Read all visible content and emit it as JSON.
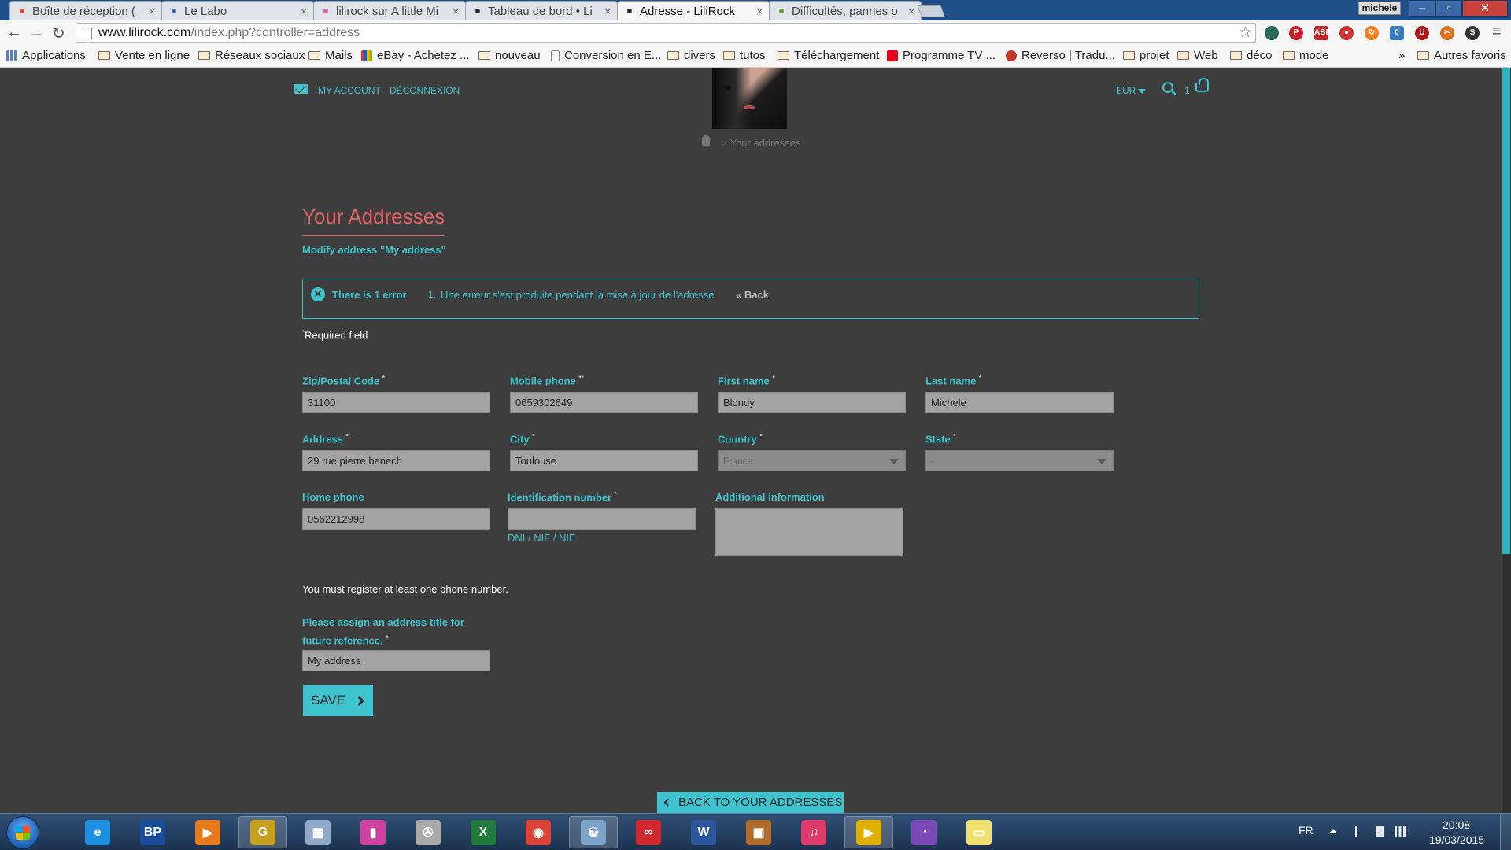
{
  "browser": {
    "tabs": [
      {
        "label": "Boîte de réception (",
        "favicon": "gmail-icon",
        "color": "#d44638"
      },
      {
        "label": "Le Labo",
        "favicon": "facebook-icon",
        "color": "#3b5998"
      },
      {
        "label": "lilirock sur A little Mi",
        "favicon": "pink-icon",
        "color": "#d85aa8"
      },
      {
        "label": "Tableau de bord • Li",
        "favicon": "prestashop-icon",
        "color": "#222222"
      },
      {
        "label": "Adresse - LiliRock",
        "favicon": "prestashop-icon",
        "color": "#222222"
      },
      {
        "label": "Difficultés, pannes o",
        "favicon": "forum-icon",
        "color": "#5a9e2f"
      }
    ],
    "close_glyph": "×",
    "user": "michele",
    "url_host": "www.lilirock.com",
    "url_path": "/index.php?controller=address",
    "bookmarks": [
      {
        "label": "Applications",
        "type": "apps"
      },
      {
        "label": "Vente en ligne",
        "type": "folder"
      },
      {
        "label": "Réseaux sociaux",
        "type": "folder"
      },
      {
        "label": "Mails",
        "type": "folder"
      },
      {
        "label": "eBay - Achetez ...",
        "type": "ebay"
      },
      {
        "label": "nouveau",
        "type": "folder"
      },
      {
        "label": "Conversion en E...",
        "type": "page"
      },
      {
        "label": "divers",
        "type": "folder"
      },
      {
        "label": "tutos",
        "type": "folder"
      },
      {
        "label": "Téléchargement",
        "type": "folder"
      },
      {
        "label": "Programme TV ...",
        "type": "sfr"
      },
      {
        "label": "Reverso | Tradu...",
        "type": "reverso"
      },
      {
        "label": "projet",
        "type": "folder"
      },
      {
        "label": "Web",
        "type": "folder"
      },
      {
        "label": "déco",
        "type": "folder"
      },
      {
        "label": "mode",
        "type": "folder"
      }
    ],
    "bookmarks_overflow": "»",
    "other_bookmarks": "Autres favoris"
  },
  "header": {
    "my_account": "MY ACCOUNT",
    "logout": "DÉCONNEXION",
    "currency": "EUR",
    "cart_count": "1"
  },
  "breadcrumb": {
    "separator": ">",
    "current": "Your addresses"
  },
  "form": {
    "title": "Your Addresses",
    "subheading": "Modify address \"My address\"",
    "error": {
      "title": "There is 1 error",
      "number": "1.",
      "message": "Une erreur s'est produite pendant la mise à jour de l'adresse",
      "back": "« Back"
    },
    "required_mark": "*",
    "required_note": "Required field",
    "fields": {
      "zip": {
        "label": "Zip/Postal Code",
        "mark": "*",
        "value": "31100"
      },
      "mobile": {
        "label": "Mobile phone",
        "mark": "**",
        "value": "0659302649"
      },
      "firstname": {
        "label": "First name",
        "mark": "*",
        "value": "Blondy"
      },
      "lastname": {
        "label": "Last name",
        "mark": "*",
        "value": "Michele"
      },
      "address": {
        "label": "Address",
        "mark": "*",
        "value": "29 rue pierre benech"
      },
      "city": {
        "label": "City",
        "mark": "*",
        "value": "Toulouse"
      },
      "country": {
        "label": "Country",
        "mark": "*",
        "value": "France"
      },
      "state": {
        "label": "State",
        "mark": "*",
        "value": "-"
      },
      "home_phone": {
        "label": "Home phone",
        "value": "0562212998"
      },
      "identification": {
        "label": "Identification number",
        "mark": "*",
        "value": ""
      },
      "additional": {
        "label": "Additional information",
        "value": ""
      }
    },
    "dni_hint": "DNI / NIF / NIE",
    "phone_note": "You must register at least one phone number.",
    "alias_label": "Please assign an address title for future reference.",
    "alias_mark": "*",
    "alias_value": "My address",
    "save": "SAVE",
    "back_to_addresses": "BACK TO YOUR ADDRESSES"
  },
  "taskbar": {
    "items": [
      {
        "name": "internet-explorer-icon",
        "color": "#1e8fe0",
        "glyph": "e"
      },
      {
        "name": "banque-populaire-icon",
        "color": "#1a4a9c",
        "glyph": "BP"
      },
      {
        "name": "media-player-icon",
        "color": "#e87a1e",
        "glyph": "▶"
      },
      {
        "name": "photo-app-icon",
        "color": "#c8a020",
        "glyph": "G"
      },
      {
        "name": "map-app-icon",
        "color": "#8fa8c8",
        "glyph": "▦"
      },
      {
        "name": "color-app-icon",
        "color": "#d040a0",
        "glyph": "▮"
      },
      {
        "name": "film-reel-icon",
        "color": "#aaaaaa",
        "glyph": "✇"
      },
      {
        "name": "excel-icon",
        "color": "#1f7a3c",
        "glyph": "X"
      },
      {
        "name": "chrome-icon",
        "color": "#db4437",
        "glyph": "◉"
      },
      {
        "name": "network-app-icon",
        "color": "#7da4c8",
        "glyph": "☯"
      },
      {
        "name": "creative-cloud-icon",
        "color": "#d0282e",
        "glyph": "∞"
      },
      {
        "name": "word-icon",
        "color": "#2b579a",
        "glyph": "W"
      },
      {
        "name": "photo-viewer-icon",
        "color": "#b06a2a",
        "glyph": "▣"
      },
      {
        "name": "itunes-icon",
        "color": "#e03a6a",
        "glyph": "♫"
      },
      {
        "name": "video-app-icon",
        "color": "#e0b000",
        "glyph": "▶"
      },
      {
        "name": "picasa-icon",
        "color": "#7a49b8",
        "glyph": "◔"
      },
      {
        "name": "sticky-notes-icon",
        "color": "#f0e070",
        "glyph": "▭"
      }
    ],
    "language": "FR",
    "time": "20:08",
    "date": "19/03/2015"
  }
}
